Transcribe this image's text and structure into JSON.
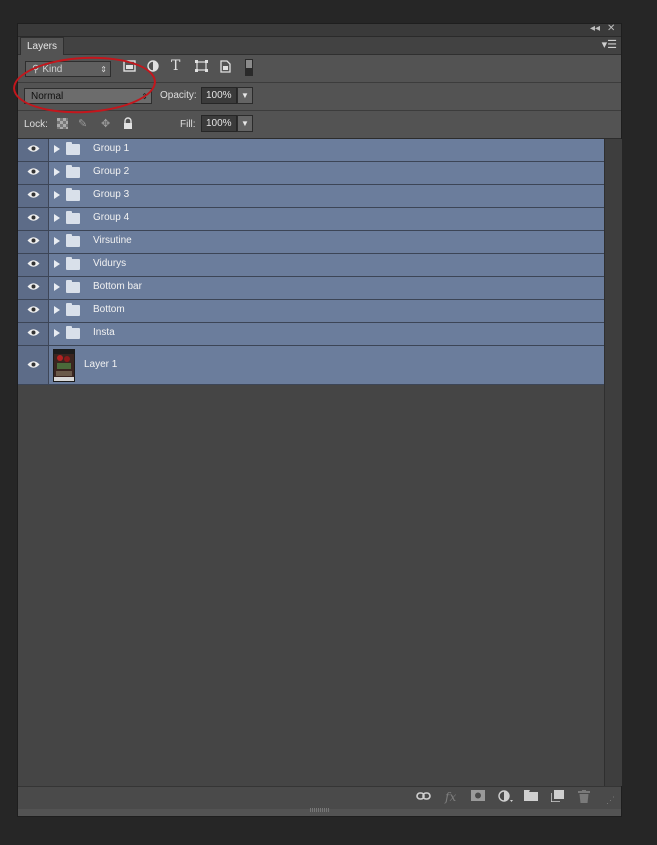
{
  "window": {
    "collapse_glyph": "◂◂",
    "close_glyph": "✕"
  },
  "panel": {
    "tab_label": "Layers",
    "menu_glyph": "▾☰"
  },
  "filter": {
    "kind_label": "Kind",
    "icons": [
      "image-filter-icon",
      "adjustment-filter-icon",
      "type-filter-icon",
      "shape-filter-icon",
      "smart-object-filter-icon",
      "filter-toggle-icon"
    ]
  },
  "blend": {
    "mode": "Normal",
    "opacity_label": "Opacity:",
    "opacity_value": "100%"
  },
  "lock": {
    "label": "Lock:",
    "fill_label": "Fill:",
    "fill_value": "100%"
  },
  "layers": [
    {
      "name": "Group 1",
      "type": "group"
    },
    {
      "name": "Group 2",
      "type": "group"
    },
    {
      "name": "Group 3",
      "type": "group"
    },
    {
      "name": "Group 4",
      "type": "group"
    },
    {
      "name": "Virsutine",
      "type": "group"
    },
    {
      "name": "Vidurys",
      "type": "group"
    },
    {
      "name": "Bottom bar",
      "type": "group"
    },
    {
      "name": "Bottom",
      "type": "group"
    },
    {
      "name": "Insta",
      "type": "group"
    },
    {
      "name": "Layer 1",
      "type": "pixel"
    }
  ],
  "bottom_bar": {
    "fx_label": "fx",
    "icons": [
      "link-icon",
      "fx-icon",
      "mask-icon",
      "adjustment-icon",
      "new-group-icon",
      "new-layer-icon",
      "trash-icon"
    ]
  },
  "colors": {
    "selected_row": "#6b7d9c",
    "annotation_circle": "#c4161c"
  }
}
